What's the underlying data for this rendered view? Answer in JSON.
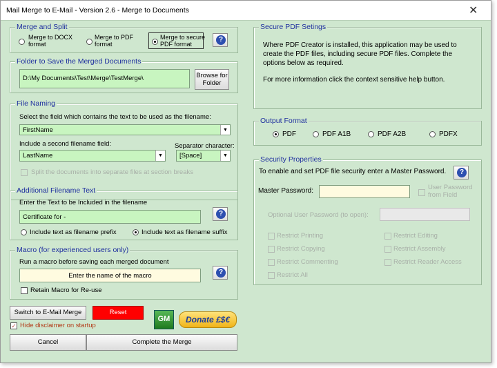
{
  "window": {
    "title": "Mail Merge to E-Mail - Version 2.6 - Merge to Documents",
    "close_glyph": "✕"
  },
  "merge_split": {
    "title": "Merge and Split",
    "opt_docx": [
      "Merge to DOCX",
      "format"
    ],
    "opt_pdf": [
      "Merge to PDF",
      "format"
    ],
    "opt_secure": [
      "Merge to secure",
      "PDF format"
    ],
    "selected": "secure"
  },
  "folder": {
    "title": "Folder to Save the Merged Documents",
    "path": "D:\\My Documents\\Test\\Merge\\TestMerge\\",
    "browse": [
      "Browse for",
      "Folder"
    ]
  },
  "naming": {
    "title": "File Naming",
    "select_label": "Select the field which contains the text to be used as the filename:",
    "field1": "FirstName",
    "include_label": "Include a second filename field:",
    "field2": "LastName",
    "sep_label": "Separator character:",
    "sep_value": "[Space]",
    "split_label": "Split the documents into separate files at section breaks"
  },
  "additional": {
    "title": "Additional Filename Text",
    "label": "Enter the Text to be Included in the filename",
    "value": "Certificate for -",
    "prefix_label": "Include text as filename prefix",
    "suffix_label": "Include text as filename suffix",
    "selected": "suffix"
  },
  "macro": {
    "title": "Macro (for experienced users only)",
    "label": "Run a macro before saving each merged document",
    "placeholder": "Enter the name of the macro",
    "retain_label": "Retain Macro for Re-use"
  },
  "bottom": {
    "switch": "Switch to E-Mail Merge",
    "reset": "Reset",
    "gm": "GM",
    "donate": "Donate £$€",
    "hide_disclaimer": "Hide disclaimer on startup",
    "cancel": "Cancel",
    "complete": "Complete the Merge"
  },
  "secure_pdf": {
    "title": "Secure PDF Setings",
    "text1": [
      "Where PDF Creator is installed, this application may be used to",
      "create the PDF files, including secure PDF files. Complete the",
      "options below as required."
    ],
    "text2": "For more information click the context sensitive help button."
  },
  "output": {
    "title": "Output Format",
    "options": [
      "PDF",
      "PDF A1B",
      "PDF A2B",
      "PDFX"
    ],
    "selected": "PDF"
  },
  "security": {
    "title": "Security Properties",
    "intro": "To enable and set PDF file security enter a Master Password.",
    "master_label": "Master Password:",
    "user_from_field": [
      "User Password",
      "from Field"
    ],
    "optional_label": "Optional User Password (to open):",
    "restrictions_left": [
      "Restrict Printing",
      "Restrict Copying",
      "Restrict Commenting",
      "Restrict All"
    ],
    "restrictions_right": [
      "Restrict Editing",
      "Restrict Assembly",
      "Restrict Reader Access"
    ]
  },
  "colors": {
    "background": "#cfe7cf",
    "field": "#c8f5c0",
    "reset": "#ff0000",
    "frame_title": "#1f2f9f"
  }
}
